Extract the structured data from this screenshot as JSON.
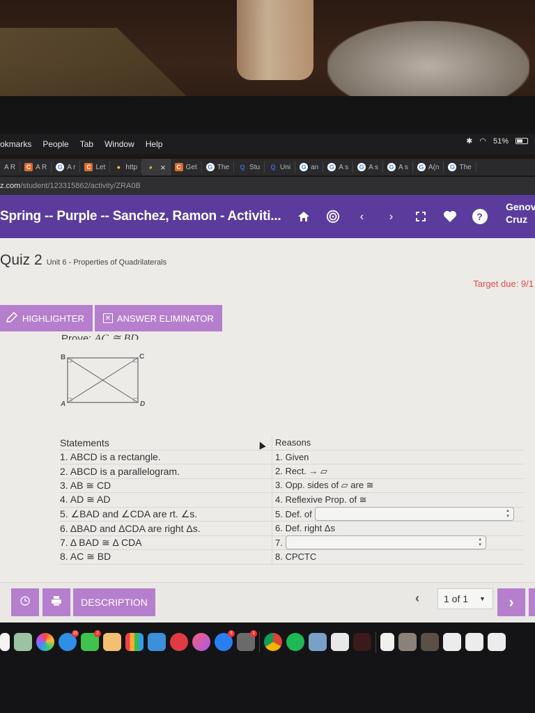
{
  "menubar": {
    "items": [
      "okmarks",
      "People",
      "Tab",
      "Window",
      "Help"
    ],
    "status": {
      "battery": "51%"
    }
  },
  "tabs": [
    {
      "icon": "none",
      "label": "A R"
    },
    {
      "icon": "c",
      "label": "A R"
    },
    {
      "icon": "g",
      "label": "A r"
    },
    {
      "icon": "c",
      "label": "Let"
    },
    {
      "icon": "bulb",
      "label": "http"
    },
    {
      "icon": "dog",
      "label": "",
      "active": true,
      "close": "×"
    },
    {
      "icon": "c",
      "label": "Get"
    },
    {
      "icon": "g",
      "label": "The"
    },
    {
      "icon": "q",
      "label": "Stu"
    },
    {
      "icon": "q",
      "label": "Uni"
    },
    {
      "icon": "g",
      "label": "an"
    },
    {
      "icon": "g",
      "label": "A s"
    },
    {
      "icon": "g",
      "label": "A s"
    },
    {
      "icon": "g",
      "label": "A s"
    },
    {
      "icon": "g",
      "label": "A(n"
    },
    {
      "icon": "g",
      "label": "The"
    }
  ],
  "address": {
    "host": "z.com",
    "path": "/student/123315862/activity/ZRA0B"
  },
  "header": {
    "title": "Spring -- Purple -- Sanchez, Ramon - Activiti...",
    "user_first": "Genov",
    "user_last": "Cruz",
    "help": "?"
  },
  "quiz": {
    "title": "Quiz 2",
    "unit": "Unit 6 - Properties of Quadrilaterals",
    "target_due": "Target due: 9/1"
  },
  "toolbar": {
    "highlighter": "HIGHLIGHTER",
    "answer_eliminator": "ANSWER ELIMINATOR"
  },
  "prove": {
    "label": "Prove:",
    "statement": "AC ≅ BD"
  },
  "diagram": {
    "labels": [
      "B",
      "C",
      "A",
      "D"
    ]
  },
  "proof": {
    "statements_header": "Statements",
    "reasons_header": "Reasons",
    "statements": [
      "1. ABCD is a rectangle.",
      "2. ABCD is a parallelogram.",
      "3. AB ≅ CD",
      "4. AD ≅ AD",
      "5. ∠BAD and ∠CDA are rt. ∠s.",
      "6. ΔBAD and ΔCDA are right Δs.",
      "7. Δ BAD ≅ Δ CDA",
      "8. AC ≅ BD"
    ],
    "reasons": [
      "1. Given",
      "2. Rect. → ▱",
      "3. Opp. sides of ▱ are ≅",
      "4. Reflexive Prop. of ≅",
      "5. Def. of",
      "6. Def. right Δs",
      "7.",
      "8. CPCTC"
    ],
    "reason5_select": "",
    "reason7_select": ""
  },
  "bottom": {
    "description": "DESCRIPTION",
    "pager": "1 of 1",
    "prev": "‹",
    "next": "›"
  }
}
